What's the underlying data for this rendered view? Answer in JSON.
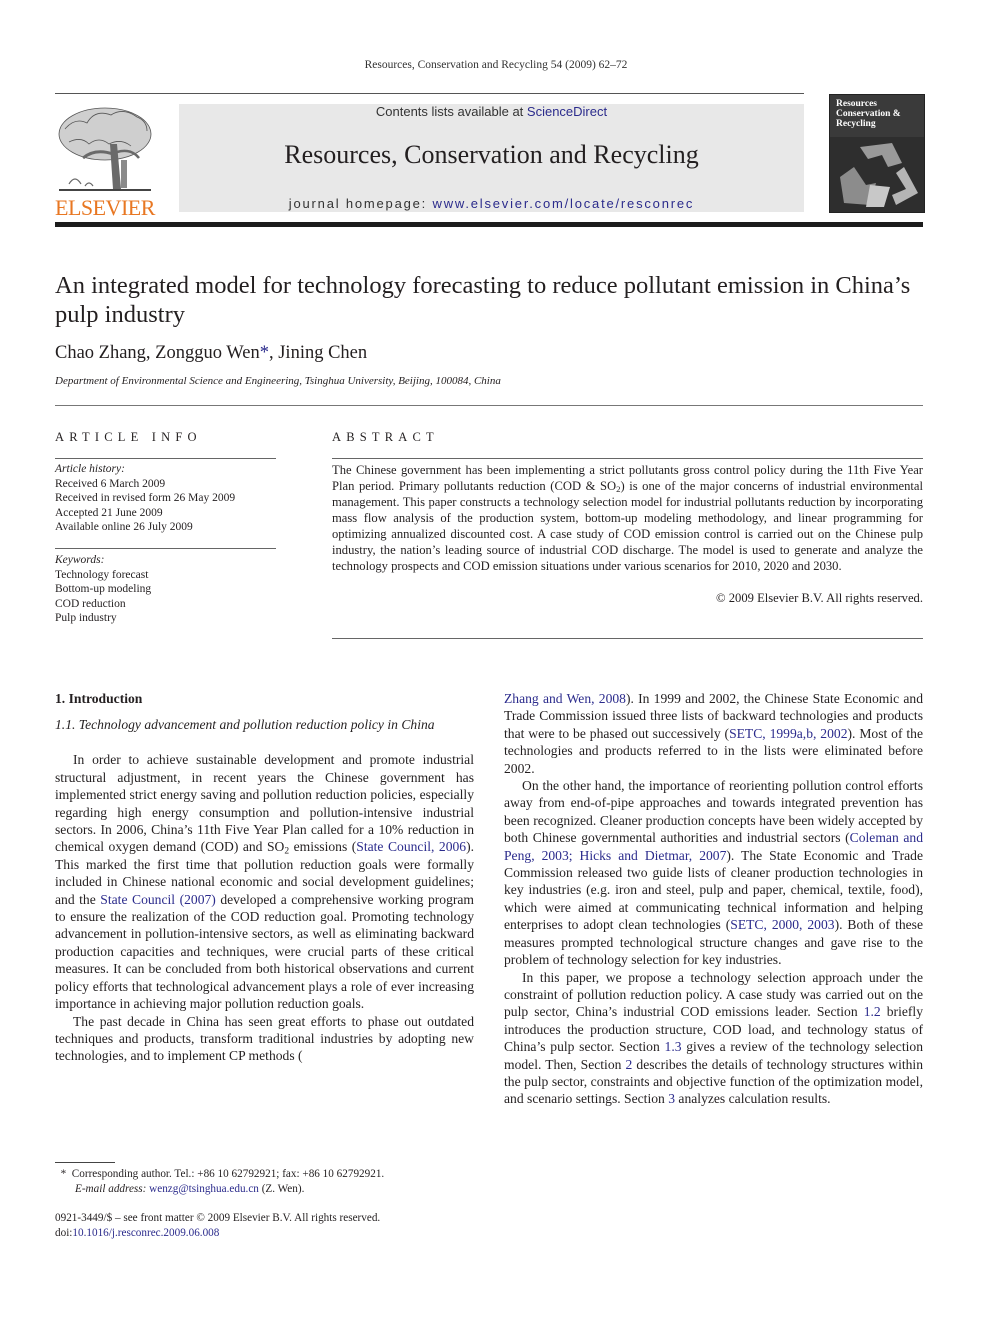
{
  "running_head": "Resources, Conservation and Recycling 54 (2009) 62–72",
  "banner": {
    "contents_prefix": "Contents lists available at ",
    "contents_link": "ScienceDirect",
    "journal_title": "Resources, Conservation and Recycling",
    "homepage_prefix": "journal homepage: ",
    "homepage_link": "www.elsevier.com/locate/resconrec",
    "publisher_logo_text": "ELSEVIER",
    "publisher_logo_color": "#e87722",
    "cover_title_lines": [
      "Resources",
      "Conservation &",
      "Recycling"
    ]
  },
  "link_color": "#2b2b8c",
  "article": {
    "title": "An integrated model for technology forecasting to reduce pollutant emission in China’s pulp industry",
    "authors_before": "Chao Zhang, Zongguo Wen",
    "author_mark": "*",
    "authors_after": ", Jining Chen",
    "affiliation": "Department of Environmental Science and Engineering, Tsinghua University, Beijing, 100084, China"
  },
  "article_info": {
    "heading": "ARTICLE INFO",
    "history_label": "Article history:",
    "history": [
      "Received 6 March 2009",
      "Received in revised form 26 May 2009",
      "Accepted 21 June 2009",
      "Available online 26 July 2009"
    ],
    "keywords_label": "Keywords:",
    "keywords": [
      "Technology forecast",
      "Bottom-up modeling",
      "COD reduction",
      "Pulp industry"
    ]
  },
  "abstract": {
    "heading": "ABSTRACT",
    "text_1": "The Chinese government has been implementing a strict pollutants gross control policy during the 11th Five Year Plan period. Primary pollutants reduction (COD & SO",
    "sub_1": "2",
    "text_2": ") is one of the major concerns of industrial environmental management. This paper constructs a technology selection model for industrial pollutants reduction by incorporating mass flow analysis of the production system, bottom-up modeling methodology, and linear programming for optimizing annualized discounted cost. A case study of COD emission control is carried out on the Chinese pulp industry, the nation’s leading source of industrial COD discharge. The model is used to generate and analyze the technology prospects and COD emission situations under various scenarios for 2010, 2020 and 2030.",
    "copyright": "© 2009 Elsevier B.V. All rights reserved."
  },
  "body": {
    "section_1_heading": "1.  Introduction",
    "subsection_1_1_heading": "1.1.  Technology advancement and pollution reduction policy in China",
    "p1": {
      "a": "In order to achieve sustainable development and promote industrial structural adjustment, in recent years the Chinese government has implemented strict energy saving and pollution reduction policies, especially regarding high energy consumption and pollution-intensive industrial sectors. In 2006, China’s 11th Five Year Plan called for a 10% reduction in chemical oxygen demand (COD) and SO",
      "sub": "2",
      "b": " emissions (",
      "link1": "State Council, 2006",
      "c": "). This marked the first time that pollution reduction goals were formally included in Chinese national economic and social development guidelines; and the ",
      "link2": "State Council (2007)",
      "d": " developed a comprehensive working program to ensure the realization of the COD reduction goal. Promoting technology advancement in pollution-intensive sectors, as well as eliminating backward production capacities and techniques, were crucial parts of these critical measures. It can be concluded from both historical observations and current policy efforts that technological advancement plays a role of ever increasing importance in achieving major pollution reduction goals."
    },
    "p2": {
      "a": "The past decade in China has seen great efforts to phase out outdated techniques and products, transform traditional industries by adopting new technologies, and to implement CP methods (",
      "link1": "Zhang and Wen, 2008",
      "b": "). In 1999 and 2002, the Chinese State Economic and Trade Commission issued three lists of backward technologies and products that were to be phased out successively (",
      "link2": "SETC, 1999a,b, 2002",
      "c": "). Most of the technologies and products referred to in the lists were eliminated before 2002."
    },
    "p3": {
      "a": "On the other hand, the importance of reorienting pollution control efforts away from end-of-pipe approaches and towards integrated prevention has been recognized. Cleaner production concepts have been widely accepted by both Chinese governmental authorities and industrial sectors (",
      "link1": "Coleman and Peng, 2003; Hicks and Dietmar, 2007",
      "b": "). The State Economic and Trade Commission released two guide lists of cleaner production technologies in key industries (e.g. iron and steel, pulp and paper, chemical, textile, food), which were aimed at communicating technical information and helping enterprises to adopt clean technologies (",
      "link2": "SETC, 2000, 2003",
      "c": "). Both of these measures prompted technological structure changes and gave rise to the problem of technology selection for key industries."
    },
    "p4": {
      "a": "In this paper, we propose a technology selection approach under the constraint of pollution reduction policy. A case study was carried out on the pulp sector, China’s industrial COD emissions leader. Section ",
      "link1": "1.2",
      "b": " briefly introduces the production structure, COD load, and technology status of China’s pulp sector. Section ",
      "link2": "1.3",
      "c": " gives a review of the technology selection model. Then, Section ",
      "link3": "2",
      "d": " describes the details of technology structures within the pulp sector, constraints and objective function of the optimization model, and scenario settings. Section ",
      "link4": "3",
      "e": " analyzes calculation results."
    }
  },
  "footnote": {
    "mark": "*",
    "line1": "Corresponding author. Tel.: +86 10 62792921; fax: +86 10 62792921.",
    "email_label": "E-mail address:",
    "email": "wenzg@tsinghua.edu.cn",
    "email_suffix": " (Z. Wen)."
  },
  "front_matter": {
    "issn_line": "0921-3449/$ – see front matter © 2009 Elsevier B.V. All rights reserved.",
    "doi_label": "doi:",
    "doi": "10.1016/j.resconrec.2009.06.008"
  }
}
